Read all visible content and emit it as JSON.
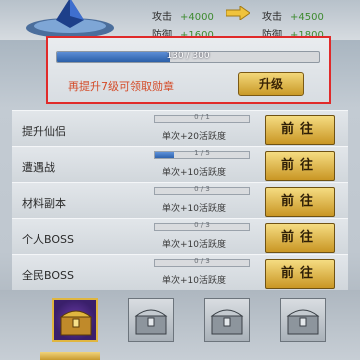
{
  "stats": {
    "current": {
      "attack_label": "攻击",
      "attack_value": "+4000",
      "defense_label": "防御",
      "defense_value": "+1600"
    },
    "next": {
      "attack_label": "攻击",
      "attack_value": "+4500",
      "defense_label": "防御",
      "defense_value": "+1800"
    }
  },
  "level_panel": {
    "progress_text": "130 / 300",
    "progress_fraction": 0.43,
    "tip": "再提升7级可领取勋章",
    "upgrade_label": "升级"
  },
  "tasks": [
    {
      "name": "提升仙侣",
      "progress": "0 / 1",
      "fraction": 0.0,
      "desc": "单次+20活跃度",
      "button": "前往"
    },
    {
      "name": "遭遇战",
      "progress": "1 / 5",
      "fraction": 0.2,
      "desc": "单次+10活跃度",
      "button": "前往"
    },
    {
      "name": "材料副本",
      "progress": "0 / 3",
      "fraction": 0.0,
      "desc": "单次+10活跃度",
      "button": "前往"
    },
    {
      "name": "个人BOSS",
      "progress": "0 / 3",
      "fraction": 0.0,
      "desc": "单次+10活跃度",
      "button": "前往"
    },
    {
      "name": "全民BOSS",
      "progress": "0 / 3",
      "fraction": 0.0,
      "desc": "单次+10活跃度",
      "button": "前往"
    }
  ],
  "chests": [
    {
      "icon": "chest-icon-purple",
      "active": true
    },
    {
      "icon": "chest-icon-silver",
      "active": false
    },
    {
      "icon": "chest-icon-silver",
      "active": false
    },
    {
      "icon": "chest-icon-silver",
      "active": false
    }
  ],
  "colors": {
    "accent_gold": "#c99624",
    "highlight_red": "#e02a2a",
    "bar_blue": "#2e62ad",
    "stat_green": "#3d8a2f"
  }
}
